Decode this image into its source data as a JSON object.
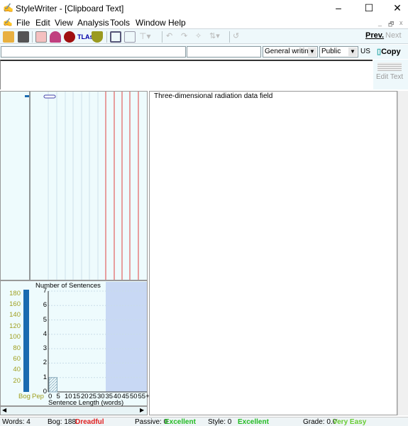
{
  "window": {
    "title": "StyleWriter - [Clipboard Text]",
    "minimize": "–",
    "maximize": "☐",
    "close": "✕"
  },
  "menu": [
    "File",
    "Edit",
    "View",
    "Analysis",
    "Tools",
    "Window",
    "Help"
  ],
  "mdi_controls": [
    "_",
    "🗗",
    "x"
  ],
  "toolbar": {
    "prev": "Prev.",
    "next": "Next",
    "icons": [
      "open-icon",
      "save-icon",
      "check-icon",
      "bell-icon",
      "head-icon",
      "tlas-icon",
      "pestle-icon",
      "panel-icon",
      "panel2-icon",
      "filter-icon",
      "arrow-icon",
      "undo-icon"
    ],
    "tlas_label": "TLAs"
  },
  "inputs": {
    "field1": "",
    "field2": "",
    "style_select": "General writing",
    "audience_select": "Public",
    "locale": "US",
    "copy": "Copy",
    "edit_text": "Edit Text"
  },
  "document": {
    "text": "Three-dimensional radiation data field"
  },
  "colors": {
    "bog_bar": "#1a6ab0",
    "red_line": "#e04040",
    "shade": "#c8d8f4",
    "dreadful": "#e02020",
    "excellent": "#22bb22"
  },
  "chart_data": [
    {
      "type": "bar",
      "categories": [
        "Bog",
        "Pep"
      ],
      "values": [
        188,
        0
      ],
      "ytick_labels": [
        "20",
        "40",
        "60",
        "80",
        "100",
        "120",
        "140",
        "160",
        "180"
      ],
      "ylim": [
        0,
        190
      ]
    },
    {
      "type": "bar",
      "title": "Number of Sentences",
      "xlabel": "Sentence Length (words)",
      "categories": [
        "0",
        "5",
        "10",
        "15",
        "20",
        "25",
        "30",
        "35",
        "40",
        "45",
        "50",
        "55+"
      ],
      "values": [
        1,
        0,
        0,
        0,
        0,
        0,
        0,
        0,
        0,
        0,
        0,
        0
      ],
      "yticks": [
        "0",
        "1",
        "2",
        "3",
        "4",
        "5",
        "6",
        "7"
      ],
      "ylim": [
        0,
        7
      ],
      "shaded_from": "35"
    }
  ],
  "status": {
    "words": "Words: 4",
    "bog": "Bog: 188",
    "bog_rating": "Dreadful",
    "passive": "Passive: 0",
    "passive_rating": "Excellent",
    "style": "Style: 0",
    "style_rating": "Excellent",
    "grade": "Grade: 0.0",
    "grade_rating": "Very Easy"
  }
}
